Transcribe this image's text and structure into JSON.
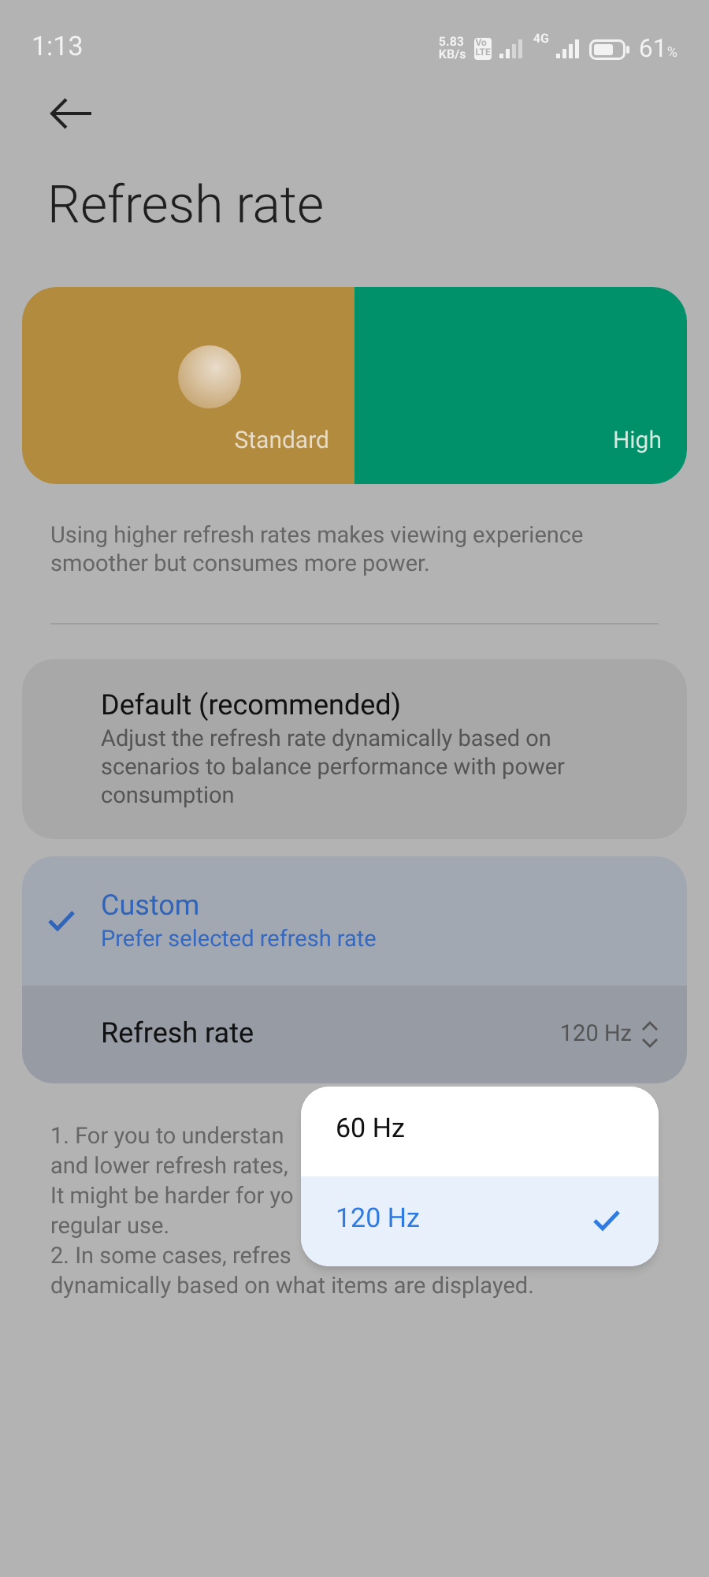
{
  "status_bar": {
    "time": "1:13",
    "net_speed": "5.83",
    "net_speed_unit": "KB/s",
    "volte_top": "Vo",
    "volte_bottom": "LTE",
    "network": "4G",
    "battery_percent": "61",
    "percent_sign": "%"
  },
  "title": "Refresh rate",
  "preview": {
    "left_label": "Standard",
    "right_label": "High"
  },
  "description": "Using higher refresh rates makes viewing experience smoother but consumes more power.",
  "modes": [
    {
      "title": "Default (recommended)",
      "subtitle": "Adjust the refresh rate dynamically based on scenarios to balance performance with power consumption",
      "selected": false
    },
    {
      "title": "Custom",
      "subtitle": "Prefer selected refresh rate",
      "selected": true,
      "setting": {
        "label": "Refresh rate",
        "value": "120 Hz"
      }
    }
  ],
  "notes": [
    "1. For you to understan",
    "and lower refresh rates,",
    "It might be harder for yo",
    "regular use.",
    "2. In some cases, refres",
    "dynamically based on what items are displayed."
  ],
  "popup_options": [
    {
      "label": "60 Hz",
      "selected": false
    },
    {
      "label": "120 Hz",
      "selected": true
    }
  ]
}
